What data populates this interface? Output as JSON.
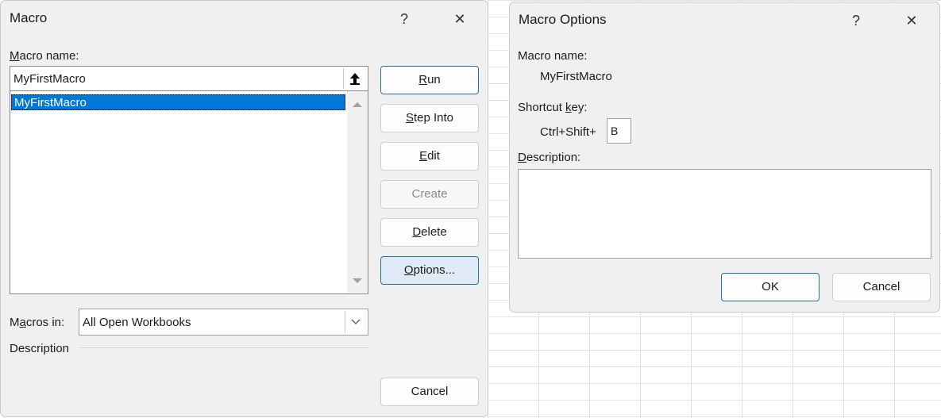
{
  "macro_dialog": {
    "title": "Macro",
    "help_glyph": "?",
    "close_glyph": "✕",
    "name_label_key": "M",
    "name_label_rest": "acro name:",
    "name_value": "MyFirstMacro",
    "list_items": [
      "MyFirstMacro"
    ],
    "selected_index": 0,
    "buttons": {
      "run": {
        "key": "R",
        "rest": "un"
      },
      "step_into": {
        "key": "S",
        "rest": "tep Into"
      },
      "edit": {
        "key": "E",
        "rest": "dit"
      },
      "create": {
        "pre": "",
        "key": "",
        "rest": "Create"
      },
      "delete": {
        "key": "D",
        "rest": "elete"
      },
      "options": {
        "key": "O",
        "rest": "ptions..."
      },
      "cancel": "Cancel"
    },
    "macros_in_pre": "M",
    "macros_in_key": "a",
    "macros_in_rest": "cros in:",
    "macros_in_value": "All Open Workbooks",
    "description_label": "Description"
  },
  "options_dialog": {
    "title": "Macro Options",
    "help_glyph": "?",
    "close_glyph": "✕",
    "macro_name_label": "Macro name:",
    "macro_name_value": "MyFirstMacro",
    "shortcut_pre": "Shortcut ",
    "shortcut_key": "k",
    "shortcut_rest": "ey:",
    "shortcut_prefix": "Ctrl+Shift+",
    "shortcut_value": "B",
    "description_key": "D",
    "description_rest": "escription:",
    "description_value": "",
    "ok_label": "OK",
    "cancel_label": "Cancel"
  }
}
